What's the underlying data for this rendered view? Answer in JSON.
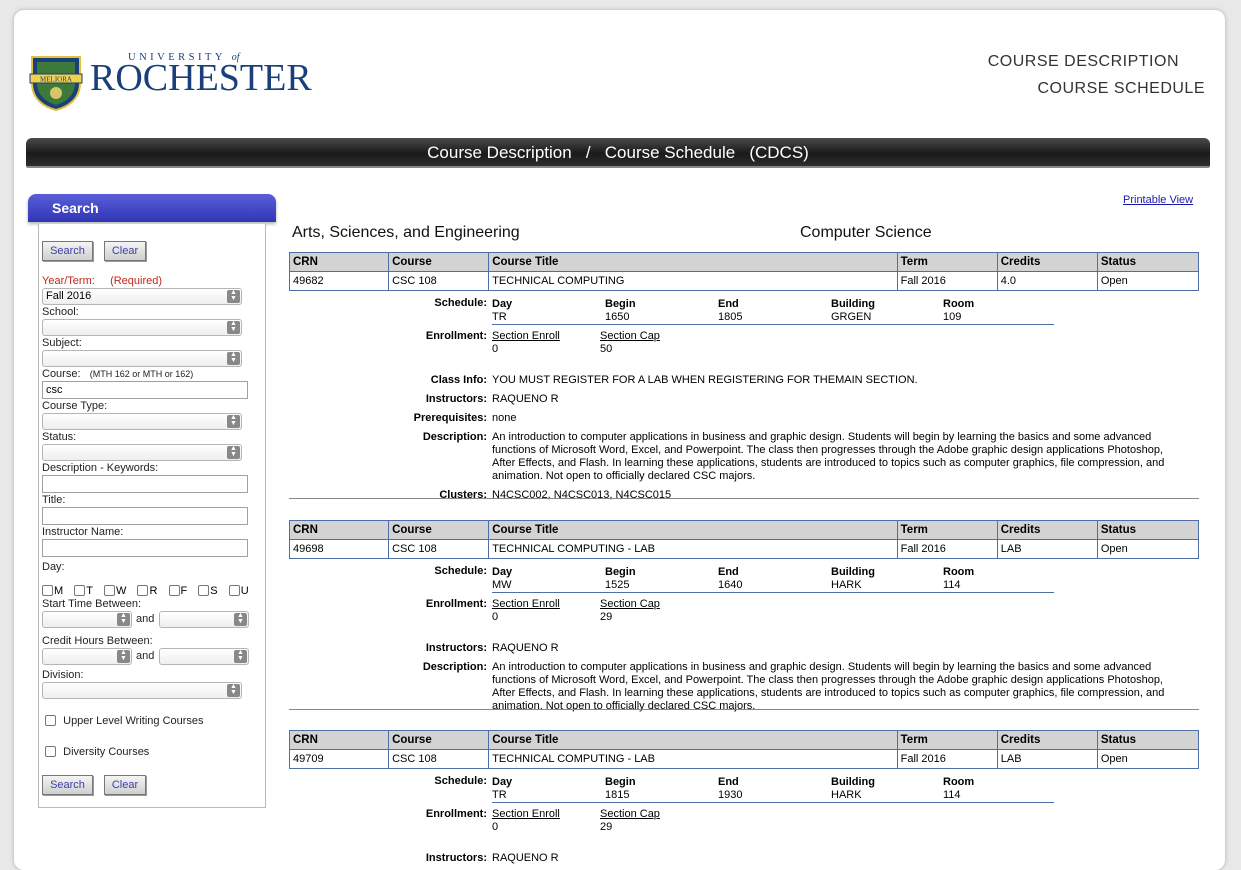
{
  "header": {
    "logo_top": "UNIVERSITY",
    "logo_of": "of",
    "logo_name": "ROCHESTER",
    "shield_text": "MELIORA",
    "title_line1": "Course Description",
    "title_line2": "Course Schedule",
    "banner": "Course Description   /   Course Schedule   (CDCS)"
  },
  "sidebar": {
    "tab": "Search",
    "search_btn": "Search",
    "clear_btn": "Clear",
    "year_term_label": "Year/Term:",
    "required": "(Required)",
    "year_term_value": "Fall 2016",
    "school_label": "School:",
    "subject_label": "Subject:",
    "course_label": "Course:",
    "course_hint": "(MTH 162 or MTH or 162)",
    "course_value": "csc",
    "course_type_label": "Course Type:",
    "status_label": "Status:",
    "desc_kw_label": "Description - Keywords:",
    "title_label": "Title:",
    "instructor_label": "Instructor Name:",
    "day_label": "Day:",
    "days": [
      "M",
      "T",
      "W",
      "R",
      "F",
      "S",
      "U"
    ],
    "start_time_label": "Start Time Between:",
    "and": "and",
    "credit_hours_label": "Credit Hours Between:",
    "division_label": "Division:",
    "ulw_label": "Upper Level Writing Courses",
    "diversity_label": "Diversity Courses"
  },
  "main": {
    "printable": "Printable View",
    "school": "Arts, Sciences, and Engineering",
    "department": "Computer Science",
    "columns": [
      "CRN",
      "Course",
      "Course Title",
      "Term",
      "Credits",
      "Status"
    ],
    "labels": {
      "schedule": "Schedule:",
      "enrollment": "Enrollment:",
      "class_info": "Class Info:",
      "instructors": "Instructors:",
      "prereq": "Prerequisites:",
      "description": "Description:",
      "clusters": "Clusters:"
    },
    "sched_cols": [
      "Day",
      "Begin",
      "End",
      "Building",
      "Room"
    ],
    "enroll_cols": [
      "Section Enroll",
      "Section Cap"
    ],
    "courses": [
      {
        "crn": "49682",
        "course": "CSC 108",
        "title": "TECHNICAL COMPUTING",
        "term": "Fall 2016",
        "credits": "4.0",
        "status": "Open",
        "day": "TR",
        "begin": "1650",
        "end": "1805",
        "building": "GRGEN",
        "room": "109",
        "enroll": "0",
        "cap": "50",
        "class_info": "YOU MUST REGISTER FOR A LAB WHEN REGISTERING FOR THEMAIN SECTION.",
        "instructors": "RAQUENO R",
        "prereq": "none",
        "description": "An introduction to computer applications in business and graphic design. Students will begin by learning the basics and some advanced functions of Microsoft Word, Excel, and Powerpoint. The class then progresses through the Adobe graphic design applications Photoshop, After Effects, and Flash. In learning these applications, students are introduced to topics such as computer graphics, file compression, and animation. Not open to officially declared CSC majors.",
        "clusters": "N4CSC002, N4CSC013, N4CSC015"
      },
      {
        "crn": "49698",
        "course": "CSC 108",
        "title": "TECHNICAL COMPUTING - LAB",
        "term": "Fall 2016",
        "credits": "LAB",
        "status": "Open",
        "day": "MW",
        "begin": "1525",
        "end": "1640",
        "building": "HARK",
        "room": "114",
        "enroll": "0",
        "cap": "29",
        "instructors": "RAQUENO R",
        "description": "An introduction to computer applications in business and graphic design. Students will begin by learning the basics and some advanced functions of Microsoft Word, Excel, and Powerpoint. The class then progresses through the Adobe graphic design applications Photoshop, After Effects, and Flash. In learning these applications, students are introduced to topics such as computer graphics, file compression, and animation. Not open to officially declared CSC majors."
      },
      {
        "crn": "49709",
        "course": "CSC 108",
        "title": "TECHNICAL COMPUTING - LAB",
        "term": "Fall 2016",
        "credits": "LAB",
        "status": "Open",
        "day": "TR",
        "begin": "1815",
        "end": "1930",
        "building": "HARK",
        "room": "114",
        "enroll": "0",
        "cap": "29",
        "instructors": "RAQUENO R"
      }
    ]
  },
  "colors": {
    "accent": "#2f35b5",
    "link": "#1a1aa8",
    "border": "#4e6fa6",
    "brand": "#1b3f7a"
  }
}
